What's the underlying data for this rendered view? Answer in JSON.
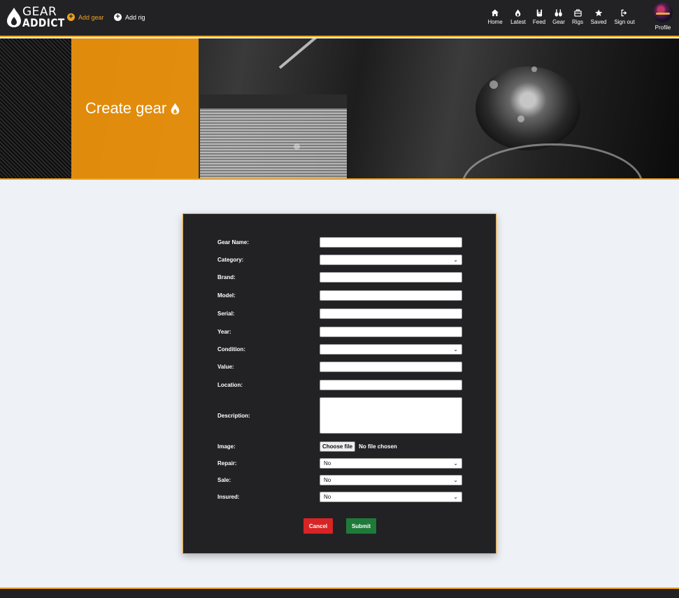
{
  "brand": {
    "line1": "GEAR",
    "line2": "ADDICT"
  },
  "quick_actions": [
    {
      "label": "Add gear",
      "icon": "plus-circle-icon"
    },
    {
      "label": "Add rig",
      "icon": "plus-circle-icon"
    }
  ],
  "nav": [
    {
      "label": "Home",
      "icon": "home-icon"
    },
    {
      "label": "Latest",
      "icon": "flame-icon"
    },
    {
      "label": "Feed",
      "icon": "rock-hand-icon"
    },
    {
      "label": "Gear",
      "icon": "guitar-icon"
    },
    {
      "label": "Rigs",
      "icon": "case-icon"
    },
    {
      "label": "Saved",
      "icon": "star-icon"
    },
    {
      "label": "Sign out",
      "icon": "sign-out-icon"
    }
  ],
  "profile": {
    "label": "Profile"
  },
  "hero": {
    "title": "Create gear"
  },
  "form": {
    "fields": [
      {
        "label": "Gear Name:",
        "value": ""
      },
      {
        "label": "Category:",
        "value": ""
      },
      {
        "label": "Brand:",
        "value": ""
      },
      {
        "label": "Model:",
        "value": ""
      },
      {
        "label": "Serial:",
        "value": ""
      },
      {
        "label": "Year:",
        "value": ""
      },
      {
        "label": "Condition:",
        "value": ""
      },
      {
        "label": "Value:",
        "value": ""
      },
      {
        "label": "Location:",
        "value": ""
      },
      {
        "label": "Description:",
        "value": ""
      },
      {
        "label": "Image:",
        "button": "Choose file",
        "status": "No file chosen"
      },
      {
        "label": "Repair:",
        "value": "No"
      },
      {
        "label": "Sale:",
        "value": "No"
      },
      {
        "label": "Insured:",
        "value": "No"
      }
    ],
    "cancel": "Cancel",
    "submit": "Submit"
  },
  "colors": {
    "accent": "#f0a21c",
    "dark": "#222225",
    "cancel": "#d82424",
    "submit": "#1f7a3a"
  }
}
